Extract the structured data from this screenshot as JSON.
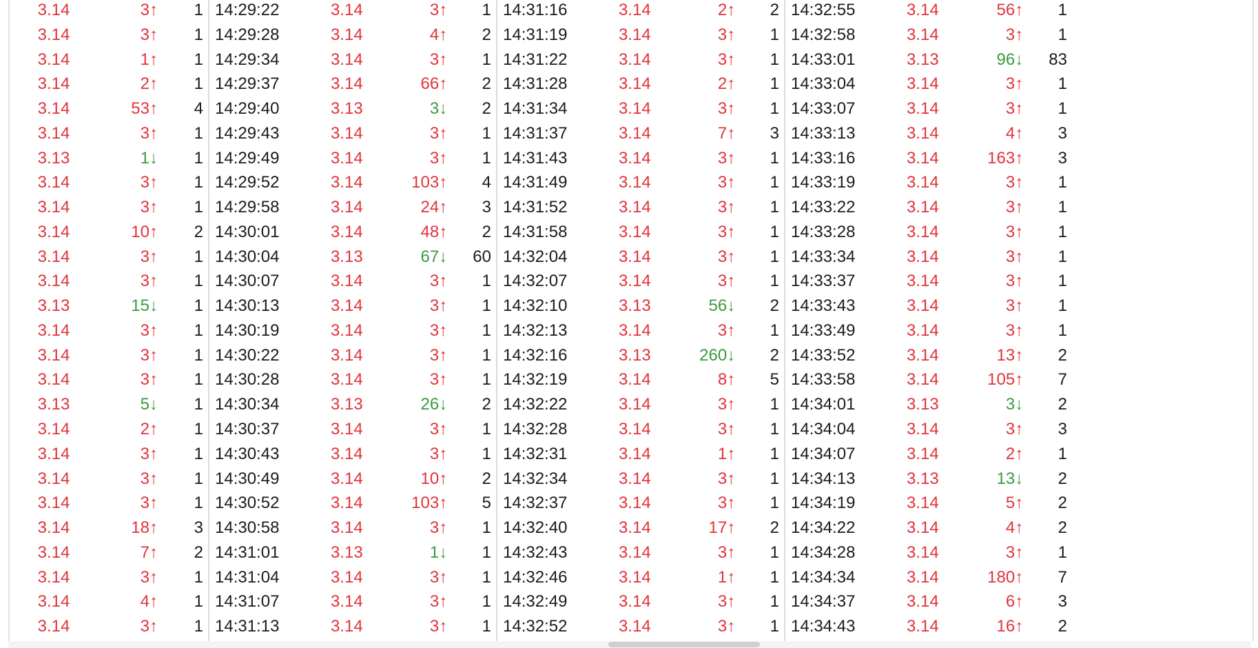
{
  "colors": {
    "up": "#e0333a",
    "down": "#3a9a3f",
    "text": "#1a1a1a"
  },
  "icons": {
    "up_arrow": "↑",
    "down_arrow": "↓"
  },
  "columns": [
    {
      "rows": [
        {
          "time": "",
          "price": "3.14",
          "vol": "3",
          "dir": "up",
          "num": "1"
        },
        {
          "time": "",
          "price": "3.14",
          "vol": "3",
          "dir": "up",
          "num": "1"
        },
        {
          "time": "",
          "price": "3.14",
          "vol": "1",
          "dir": "up",
          "num": "1"
        },
        {
          "time": "",
          "price": "3.14",
          "vol": "2",
          "dir": "up",
          "num": "1"
        },
        {
          "time": "",
          "price": "3.14",
          "vol": "53",
          "dir": "up",
          "num": "4"
        },
        {
          "time": "",
          "price": "3.14",
          "vol": "3",
          "dir": "up",
          "num": "1"
        },
        {
          "time": "",
          "price": "3.13",
          "vol": "1",
          "dir": "down",
          "num": "1"
        },
        {
          "time": "",
          "price": "3.14",
          "vol": "3",
          "dir": "up",
          "num": "1"
        },
        {
          "time": "",
          "price": "3.14",
          "vol": "3",
          "dir": "up",
          "num": "1"
        },
        {
          "time": "",
          "price": "3.14",
          "vol": "10",
          "dir": "up",
          "num": "2"
        },
        {
          "time": "",
          "price": "3.14",
          "vol": "3",
          "dir": "up",
          "num": "1"
        },
        {
          "time": "",
          "price": "3.14",
          "vol": "3",
          "dir": "up",
          "num": "1"
        },
        {
          "time": "",
          "price": "3.13",
          "vol": "15",
          "dir": "down",
          "num": "1"
        },
        {
          "time": "",
          "price": "3.14",
          "vol": "3",
          "dir": "up",
          "num": "1"
        },
        {
          "time": "",
          "price": "3.14",
          "vol": "3",
          "dir": "up",
          "num": "1"
        },
        {
          "time": "",
          "price": "3.14",
          "vol": "3",
          "dir": "up",
          "num": "1"
        },
        {
          "time": "",
          "price": "3.13",
          "vol": "5",
          "dir": "down",
          "num": "1"
        },
        {
          "time": "",
          "price": "3.14",
          "vol": "2",
          "dir": "up",
          "num": "1"
        },
        {
          "time": "",
          "price": "3.14",
          "vol": "3",
          "dir": "up",
          "num": "1"
        },
        {
          "time": "",
          "price": "3.14",
          "vol": "3",
          "dir": "up",
          "num": "1"
        },
        {
          "time": "",
          "price": "3.14",
          "vol": "3",
          "dir": "up",
          "num": "1"
        },
        {
          "time": "",
          "price": "3.14",
          "vol": "18",
          "dir": "up",
          "num": "3"
        },
        {
          "time": "",
          "price": "3.14",
          "vol": "7",
          "dir": "up",
          "num": "2"
        },
        {
          "time": "",
          "price": "3.14",
          "vol": "3",
          "dir": "up",
          "num": "1"
        },
        {
          "time": "",
          "price": "3.14",
          "vol": "4",
          "dir": "up",
          "num": "1"
        },
        {
          "time": "",
          "price": "3.14",
          "vol": "3",
          "dir": "up",
          "num": "1"
        }
      ]
    },
    {
      "rows": [
        {
          "time": "14:29:22",
          "price": "3.14",
          "vol": "3",
          "dir": "up",
          "num": "1"
        },
        {
          "time": "14:29:28",
          "price": "3.14",
          "vol": "4",
          "dir": "up",
          "num": "2"
        },
        {
          "time": "14:29:34",
          "price": "3.14",
          "vol": "3",
          "dir": "up",
          "num": "1"
        },
        {
          "time": "14:29:37",
          "price": "3.14",
          "vol": "66",
          "dir": "up",
          "num": "2"
        },
        {
          "time": "14:29:40",
          "price": "3.13",
          "vol": "3",
          "dir": "down",
          "num": "2"
        },
        {
          "time": "14:29:43",
          "price": "3.14",
          "vol": "3",
          "dir": "up",
          "num": "1"
        },
        {
          "time": "14:29:49",
          "price": "3.14",
          "vol": "3",
          "dir": "up",
          "num": "1"
        },
        {
          "time": "14:29:52",
          "price": "3.14",
          "vol": "103",
          "dir": "up",
          "num": "4"
        },
        {
          "time": "14:29:58",
          "price": "3.14",
          "vol": "24",
          "dir": "up",
          "num": "3"
        },
        {
          "time": "14:30:01",
          "price": "3.14",
          "vol": "48",
          "dir": "up",
          "num": "2"
        },
        {
          "time": "14:30:04",
          "price": "3.13",
          "vol": "67",
          "dir": "down",
          "num": "60"
        },
        {
          "time": "14:30:07",
          "price": "3.14",
          "vol": "3",
          "dir": "up",
          "num": "1"
        },
        {
          "time": "14:30:13",
          "price": "3.14",
          "vol": "3",
          "dir": "up",
          "num": "1"
        },
        {
          "time": "14:30:19",
          "price": "3.14",
          "vol": "3",
          "dir": "up",
          "num": "1"
        },
        {
          "time": "14:30:22",
          "price": "3.14",
          "vol": "3",
          "dir": "up",
          "num": "1"
        },
        {
          "time": "14:30:28",
          "price": "3.14",
          "vol": "3",
          "dir": "up",
          "num": "1"
        },
        {
          "time": "14:30:34",
          "price": "3.13",
          "vol": "26",
          "dir": "down",
          "num": "2"
        },
        {
          "time": "14:30:37",
          "price": "3.14",
          "vol": "3",
          "dir": "up",
          "num": "1"
        },
        {
          "time": "14:30:43",
          "price": "3.14",
          "vol": "3",
          "dir": "up",
          "num": "1"
        },
        {
          "time": "14:30:49",
          "price": "3.14",
          "vol": "10",
          "dir": "up",
          "num": "2"
        },
        {
          "time": "14:30:52",
          "price": "3.14",
          "vol": "103",
          "dir": "up",
          "num": "5"
        },
        {
          "time": "14:30:58",
          "price": "3.14",
          "vol": "3",
          "dir": "up",
          "num": "1"
        },
        {
          "time": "14:31:01",
          "price": "3.13",
          "vol": "1",
          "dir": "down",
          "num": "1"
        },
        {
          "time": "14:31:04",
          "price": "3.14",
          "vol": "3",
          "dir": "up",
          "num": "1"
        },
        {
          "time": "14:31:07",
          "price": "3.14",
          "vol": "3",
          "dir": "up",
          "num": "1"
        },
        {
          "time": "14:31:13",
          "price": "3.14",
          "vol": "3",
          "dir": "up",
          "num": "1"
        }
      ]
    },
    {
      "rows": [
        {
          "time": "14:31:16",
          "price": "3.14",
          "vol": "2",
          "dir": "up",
          "num": "2"
        },
        {
          "time": "14:31:19",
          "price": "3.14",
          "vol": "3",
          "dir": "up",
          "num": "1"
        },
        {
          "time": "14:31:22",
          "price": "3.14",
          "vol": "3",
          "dir": "up",
          "num": "1"
        },
        {
          "time": "14:31:28",
          "price": "3.14",
          "vol": "2",
          "dir": "up",
          "num": "1"
        },
        {
          "time": "14:31:34",
          "price": "3.14",
          "vol": "3",
          "dir": "up",
          "num": "1"
        },
        {
          "time": "14:31:37",
          "price": "3.14",
          "vol": "7",
          "dir": "up",
          "num": "3"
        },
        {
          "time": "14:31:43",
          "price": "3.14",
          "vol": "3",
          "dir": "up",
          "num": "1"
        },
        {
          "time": "14:31:49",
          "price": "3.14",
          "vol": "3",
          "dir": "up",
          "num": "1"
        },
        {
          "time": "14:31:52",
          "price": "3.14",
          "vol": "3",
          "dir": "up",
          "num": "1"
        },
        {
          "time": "14:31:58",
          "price": "3.14",
          "vol": "3",
          "dir": "up",
          "num": "1"
        },
        {
          "time": "14:32:04",
          "price": "3.14",
          "vol": "3",
          "dir": "up",
          "num": "1"
        },
        {
          "time": "14:32:07",
          "price": "3.14",
          "vol": "3",
          "dir": "up",
          "num": "1"
        },
        {
          "time": "14:32:10",
          "price": "3.13",
          "vol": "56",
          "dir": "down",
          "num": "2"
        },
        {
          "time": "14:32:13",
          "price": "3.14",
          "vol": "3",
          "dir": "up",
          "num": "1"
        },
        {
          "time": "14:32:16",
          "price": "3.13",
          "vol": "260",
          "dir": "down",
          "num": "2"
        },
        {
          "time": "14:32:19",
          "price": "3.14",
          "vol": "8",
          "dir": "up",
          "num": "5"
        },
        {
          "time": "14:32:22",
          "price": "3.14",
          "vol": "3",
          "dir": "up",
          "num": "1"
        },
        {
          "time": "14:32:28",
          "price": "3.14",
          "vol": "3",
          "dir": "up",
          "num": "1"
        },
        {
          "time": "14:32:31",
          "price": "3.14",
          "vol": "1",
          "dir": "up",
          "num": "1"
        },
        {
          "time": "14:32:34",
          "price": "3.14",
          "vol": "3",
          "dir": "up",
          "num": "1"
        },
        {
          "time": "14:32:37",
          "price": "3.14",
          "vol": "3",
          "dir": "up",
          "num": "1"
        },
        {
          "time": "14:32:40",
          "price": "3.14",
          "vol": "17",
          "dir": "up",
          "num": "2"
        },
        {
          "time": "14:32:43",
          "price": "3.14",
          "vol": "3",
          "dir": "up",
          "num": "1"
        },
        {
          "time": "14:32:46",
          "price": "3.14",
          "vol": "1",
          "dir": "up",
          "num": "1"
        },
        {
          "time": "14:32:49",
          "price": "3.14",
          "vol": "3",
          "dir": "up",
          "num": "1"
        },
        {
          "time": "14:32:52",
          "price": "3.14",
          "vol": "3",
          "dir": "up",
          "num": "1"
        }
      ]
    },
    {
      "rows": [
        {
          "time": "14:32:55",
          "price": "3.14",
          "vol": "56",
          "dir": "up",
          "num": "1"
        },
        {
          "time": "14:32:58",
          "price": "3.14",
          "vol": "3",
          "dir": "up",
          "num": "1"
        },
        {
          "time": "14:33:01",
          "price": "3.13",
          "vol": "96",
          "dir": "down",
          "num": "83"
        },
        {
          "time": "14:33:04",
          "price": "3.14",
          "vol": "3",
          "dir": "up",
          "num": "1"
        },
        {
          "time": "14:33:07",
          "price": "3.14",
          "vol": "3",
          "dir": "up",
          "num": "1"
        },
        {
          "time": "14:33:13",
          "price": "3.14",
          "vol": "4",
          "dir": "up",
          "num": "3"
        },
        {
          "time": "14:33:16",
          "price": "3.14",
          "vol": "163",
          "dir": "up",
          "num": "3"
        },
        {
          "time": "14:33:19",
          "price": "3.14",
          "vol": "3",
          "dir": "up",
          "num": "1"
        },
        {
          "time": "14:33:22",
          "price": "3.14",
          "vol": "3",
          "dir": "up",
          "num": "1"
        },
        {
          "time": "14:33:28",
          "price": "3.14",
          "vol": "3",
          "dir": "up",
          "num": "1"
        },
        {
          "time": "14:33:34",
          "price": "3.14",
          "vol": "3",
          "dir": "up",
          "num": "1"
        },
        {
          "time": "14:33:37",
          "price": "3.14",
          "vol": "3",
          "dir": "up",
          "num": "1"
        },
        {
          "time": "14:33:43",
          "price": "3.14",
          "vol": "3",
          "dir": "up",
          "num": "1"
        },
        {
          "time": "14:33:49",
          "price": "3.14",
          "vol": "3",
          "dir": "up",
          "num": "1"
        },
        {
          "time": "14:33:52",
          "price": "3.14",
          "vol": "13",
          "dir": "up",
          "num": "2"
        },
        {
          "time": "14:33:58",
          "price": "3.14",
          "vol": "105",
          "dir": "up",
          "num": "7"
        },
        {
          "time": "14:34:01",
          "price": "3.13",
          "vol": "3",
          "dir": "down",
          "num": "2"
        },
        {
          "time": "14:34:04",
          "price": "3.14",
          "vol": "3",
          "dir": "up",
          "num": "3"
        },
        {
          "time": "14:34:07",
          "price": "3.14",
          "vol": "2",
          "dir": "up",
          "num": "1"
        },
        {
          "time": "14:34:13",
          "price": "3.13",
          "vol": "13",
          "dir": "down",
          "num": "2"
        },
        {
          "time": "14:34:19",
          "price": "3.14",
          "vol": "5",
          "dir": "up",
          "num": "2"
        },
        {
          "time": "14:34:22",
          "price": "3.14",
          "vol": "4",
          "dir": "up",
          "num": "2"
        },
        {
          "time": "14:34:28",
          "price": "3.14",
          "vol": "3",
          "dir": "up",
          "num": "1"
        },
        {
          "time": "14:34:34",
          "price": "3.14",
          "vol": "180",
          "dir": "up",
          "num": "7"
        },
        {
          "time": "14:34:37",
          "price": "3.14",
          "vol": "6",
          "dir": "up",
          "num": "3"
        },
        {
          "time": "14:34:43",
          "price": "3.14",
          "vol": "16",
          "dir": "up",
          "num": "2"
        }
      ]
    }
  ]
}
